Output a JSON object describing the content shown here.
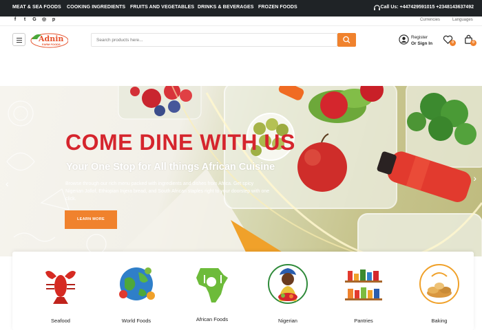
{
  "topbar": {
    "categories": [
      "MEAT & SEA FOODS",
      "COOKING INGREDIENTS",
      "FRUITS AND VEGETABLES",
      "DRINKS & BEVERAGES",
      "FROZEN FOODS"
    ],
    "call": "Call Us: +447429591015 +2348143637492"
  },
  "utility": {
    "currencies": "Currencies",
    "languages": "Languages"
  },
  "brand": {
    "name": "Adnin",
    "tagline": "FARM FOODS",
    "accent": "#f0822d",
    "dark": "#1f2326",
    "red": "#d5252d"
  },
  "search": {
    "placeholder": "Search products here..."
  },
  "account": {
    "register": "Register",
    "signin": "Or Sign In",
    "wishlist_count": "0",
    "cart_count": "0"
  },
  "hero": {
    "title": "COME DINE WITH US",
    "subtitle": "Your One Stop for All things African Cuisine",
    "description": "Browse through our rich menu packed with ingredients and dishes from Africa. Get spicy Nigerian Jollof, Ethiopian Injera bread, and South African staples right to your doorstep with one click.",
    "button": "LEARN MORE"
  },
  "categories": [
    "Seafood",
    "World Foods",
    "African Foods",
    "Nigerian",
    "Pantries",
    "Baking"
  ]
}
